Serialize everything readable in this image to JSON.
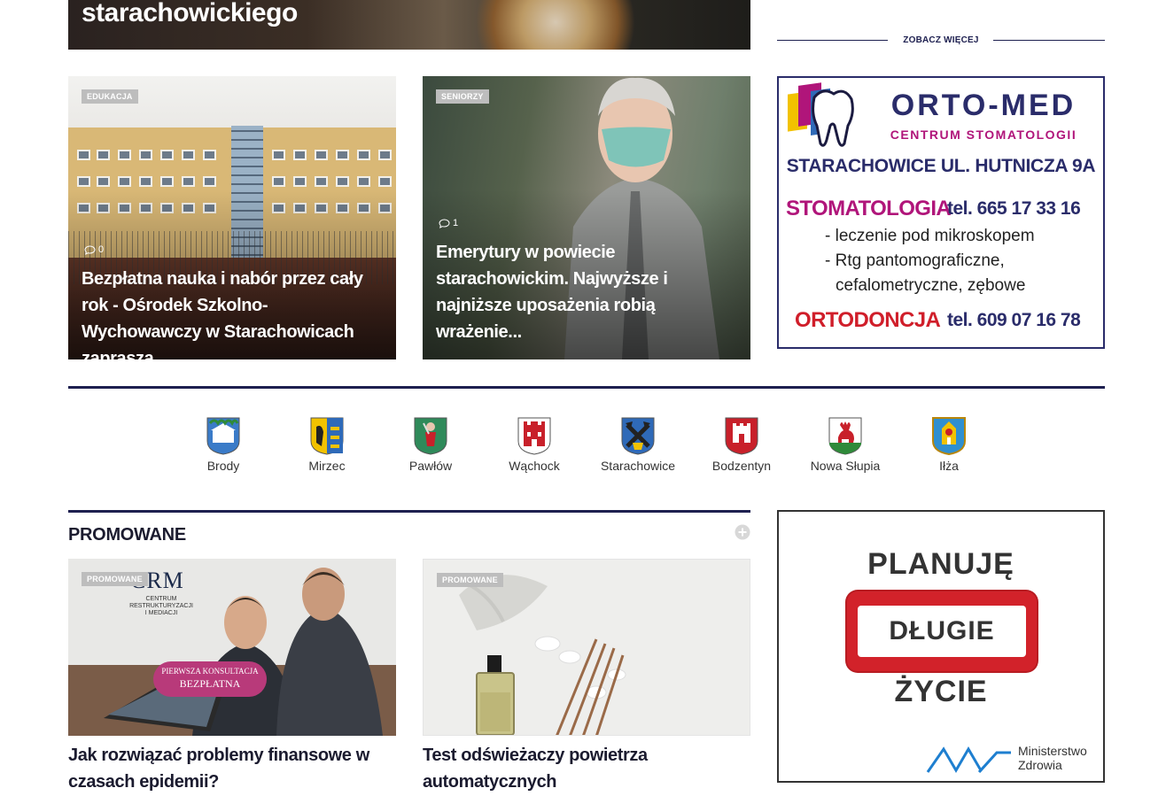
{
  "hero_top": {
    "title": "starachowickiego"
  },
  "see_more": {
    "label": "ZOBACZ WIĘCEJ"
  },
  "news_cards": [
    {
      "category": "EDUKACJA",
      "comments": "0",
      "title": "Bezpłatna nauka i nabór przez cały rok - Ośrodek Szkolno-Wychowawczy w Starachowicach zaprasza"
    },
    {
      "category": "SENIORZY",
      "comments": "1",
      "title": "Emerytury w powiecie starachowickim. Najwyższe i najniższe uposażenia robią wrażenie..."
    }
  ],
  "ad_ortomed": {
    "brand": "ORTO-MED",
    "subtitle": "CENTRUM STOMATOLOGII",
    "address": "STARACHOWICE  UL. HUTNICZA 9A",
    "line1_label": "STOMATOLOGIA",
    "line1_tel": "tel. 665 17 33 16",
    "bullet1": "- leczenie pod mikroskopem",
    "bullet2": "- Rtg pantomograficzne,",
    "bullet3": "cefalometryczne, zębowe",
    "line2_label": "ORTODONCJA",
    "line2_tel": "tel. 609 07 16 78"
  },
  "municipalities": [
    {
      "name": "Brody",
      "color": "#3a7bc8"
    },
    {
      "name": "Mirzec",
      "color": "#f2c200"
    },
    {
      "name": "Pawłów",
      "color": "#2f8a5a"
    },
    {
      "name": "Wąchock",
      "color": "#c8202a"
    },
    {
      "name": "Starachowice",
      "color": "#2f6ab8"
    },
    {
      "name": "Bodzentyn",
      "color": "#c8202a"
    },
    {
      "name": "Nowa Słupia",
      "color": "#c8202a"
    },
    {
      "name": "Iłża",
      "color": "#2f8fd0"
    }
  ],
  "promo": {
    "heading": "PROMOWANE",
    "cards": [
      {
        "category": "PROMOWANE",
        "title": "Jak rozwiązać problemy finansowe w czasach epidemii?",
        "logo_text": "CRM",
        "logo_sub1": "CENTRUM",
        "logo_sub2": "RESTRUKTURYZACJI",
        "logo_sub3": "I MEDIACJI",
        "banner1": "PIERWSZA KONSULTACJA",
        "banner2": "BEZPŁATNA"
      },
      {
        "category": "PROMOWANE",
        "title": "Test odświeżaczy powietrza automatycznych"
      }
    ]
  },
  "ad_planuje": {
    "line1": "PLANUJĘ",
    "line2": "DŁUGIE",
    "line3": "ŻYCIE",
    "ministry1": "Ministerstwo",
    "ministry2": "Zdrowia"
  },
  "colors": {
    "navy": "#1e2050",
    "badge_gray": "#bdbdbd",
    "ortomed_blue": "#2a2c6a",
    "ortomed_magenta": "#b0157a",
    "ortomed_red": "#d01e2a",
    "planuje_red": "#d2222a"
  }
}
